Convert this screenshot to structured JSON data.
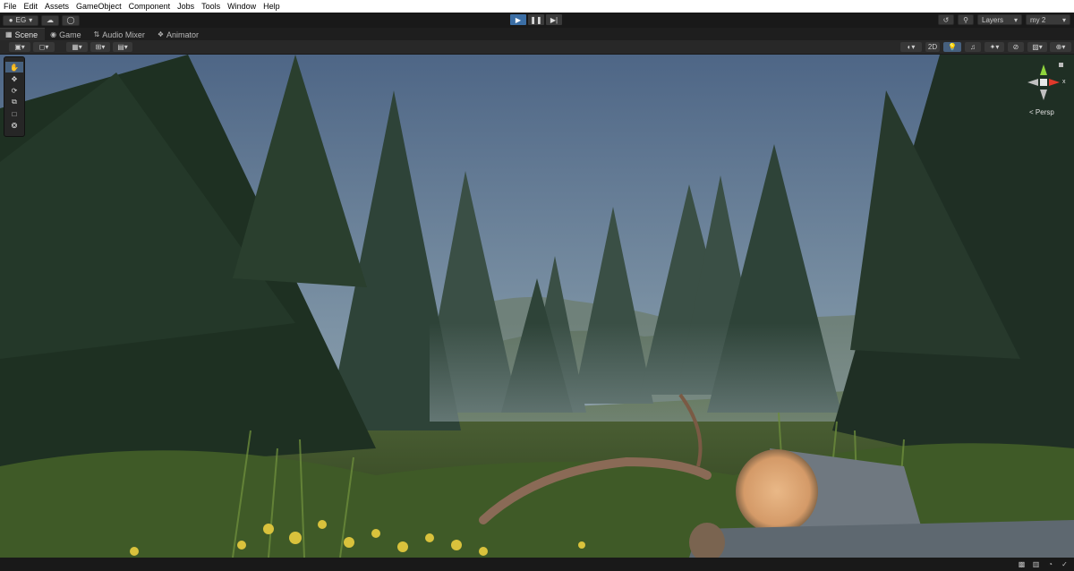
{
  "menu": [
    "File",
    "Edit",
    "Assets",
    "GameObject",
    "Component",
    "Jobs",
    "Tools",
    "Window",
    "Help"
  ],
  "toolbar": {
    "account_label": "EG",
    "layers_label": "Layers",
    "layout_label": "my 2"
  },
  "tabs": [
    {
      "label": "Scene",
      "icon": "scene-icon"
    },
    {
      "label": "Game",
      "icon": "game-controller-icon"
    },
    {
      "label": "Audio Mixer",
      "icon": "audio-mixer-icon"
    },
    {
      "label": "Animator",
      "icon": "animator-icon"
    }
  ],
  "scene_toolbar": {
    "mode_2d_label": "2D"
  },
  "gizmo": {
    "projection_label": "Persp",
    "x_axis": "x",
    "colors": {
      "x": "#e0392b",
      "y": "#8fd43c",
      "z": "#3d7edb"
    }
  },
  "tools": [
    "hand-tool-icon",
    "move-tool-icon",
    "rotate-tool-icon",
    "scale-tool-icon",
    "rect-tool-icon",
    "transform-tool-icon"
  ],
  "colors": {
    "play_active": "#3b6ea5",
    "menu_bg": "#ffffff",
    "editor_bg": "#1e1e1e"
  }
}
